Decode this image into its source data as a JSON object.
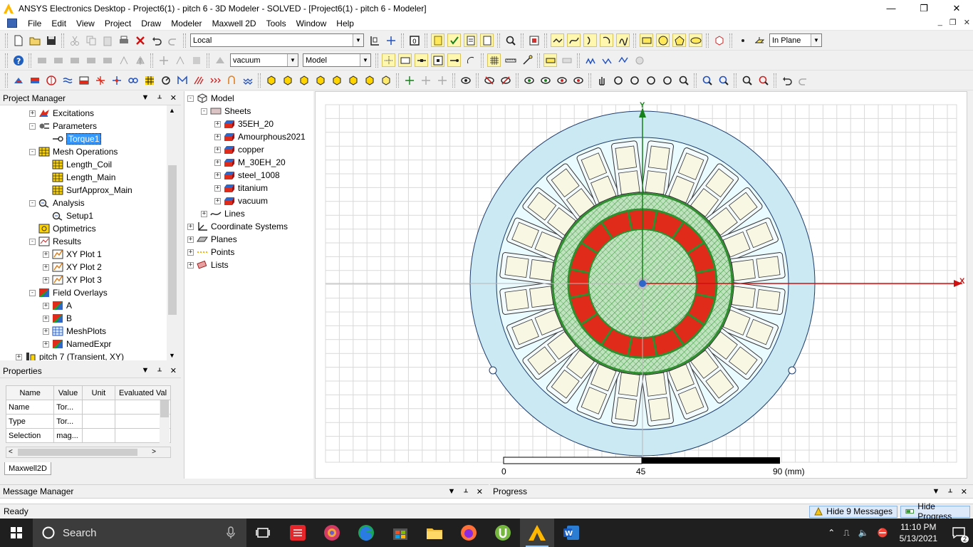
{
  "window": {
    "title": "ANSYS Electronics Desktop - Project6(1) - pitch  6 - 3D Modeler - SOLVED - [Project6(1) - pitch  6 - Modeler]",
    "minimize": "—",
    "maximize": "❐",
    "close": "✕"
  },
  "menu": [
    "File",
    "Edit",
    "View",
    "Project",
    "Draw",
    "Modeler",
    "Maxwell 2D",
    "Tools",
    "Window",
    "Help"
  ],
  "mdi_controls": [
    "_",
    "❐",
    "✕"
  ],
  "toolbar": {
    "coord_system": "Local",
    "plane_mode": "In Plane",
    "material": "vacuum",
    "model_type": "Model"
  },
  "project_manager": {
    "title": "Project Manager",
    "items": [
      {
        "label": "Excitations",
        "icon": "excitation-icon",
        "indent": 1,
        "exp": "+"
      },
      {
        "label": "Parameters",
        "icon": "parameters-icon",
        "indent": 1,
        "exp": "-"
      },
      {
        "label": "Torque1",
        "icon": "torque-icon",
        "indent": 2,
        "exp": "",
        "selected": true
      },
      {
        "label": "Mesh Operations",
        "icon": "mesh-icon",
        "indent": 1,
        "exp": "-"
      },
      {
        "label": "Length_Coil",
        "icon": "mesh-icon",
        "indent": 2,
        "exp": ""
      },
      {
        "label": "Length_Main",
        "icon": "mesh-icon",
        "indent": 2,
        "exp": ""
      },
      {
        "label": "SurfApprox_Main",
        "icon": "mesh-icon",
        "indent": 2,
        "exp": ""
      },
      {
        "label": "Analysis",
        "icon": "analysis-icon",
        "indent": 1,
        "exp": "-"
      },
      {
        "label": "Setup1",
        "icon": "analysis-icon",
        "indent": 2,
        "exp": ""
      },
      {
        "label": "Optimetrics",
        "icon": "optimetrics-icon",
        "indent": 1,
        "exp": ""
      },
      {
        "label": "Results",
        "icon": "results-icon",
        "indent": 1,
        "exp": "-"
      },
      {
        "label": "XY Plot 1",
        "icon": "plot-icon",
        "indent": 2,
        "exp": "+"
      },
      {
        "label": "XY Plot 2",
        "icon": "plot-icon",
        "indent": 2,
        "exp": "+"
      },
      {
        "label": "XY Plot 3",
        "icon": "plot-icon",
        "indent": 2,
        "exp": "+"
      },
      {
        "label": "Field Overlays",
        "icon": "field-icon",
        "indent": 1,
        "exp": "-"
      },
      {
        "label": "A",
        "icon": "field-icon",
        "indent": 2,
        "exp": "+"
      },
      {
        "label": "B",
        "icon": "field-icon",
        "indent": 2,
        "exp": "+"
      },
      {
        "label": "MeshPlots",
        "icon": "meshplot-icon",
        "indent": 2,
        "exp": "+"
      },
      {
        "label": "NamedExpr",
        "icon": "field-icon",
        "indent": 2,
        "exp": "+"
      },
      {
        "label": "pitch  7 (Transient, XY)",
        "icon": "design-icon",
        "indent": 0,
        "exp": "+"
      }
    ]
  },
  "properties": {
    "title": "Properties",
    "headers": [
      "Name",
      "Value",
      "Unit",
      "Evaluated Val"
    ],
    "rows": [
      [
        "Name",
        "Tor...",
        "",
        ""
      ],
      [
        "Type",
        "Tor...",
        "",
        ""
      ],
      [
        "Selection",
        "mag...",
        "",
        ""
      ]
    ],
    "tab": "Maxwell2D"
  },
  "model_tree": {
    "items": [
      {
        "label": "Model",
        "icon": "model-icon",
        "indent": 0,
        "exp": "-"
      },
      {
        "label": "Sheets",
        "icon": "sheets-icon",
        "indent": 1,
        "exp": "-"
      },
      {
        "label": "35EH_20",
        "icon": "material-icon",
        "indent": 2,
        "exp": "+"
      },
      {
        "label": "Amourphous2021",
        "icon": "material-icon",
        "indent": 2,
        "exp": "+"
      },
      {
        "label": "copper",
        "icon": "material-icon",
        "indent": 2,
        "exp": "+"
      },
      {
        "label": "M_30EH_20",
        "icon": "material-icon",
        "indent": 2,
        "exp": "+"
      },
      {
        "label": "steel_1008",
        "icon": "material-icon",
        "indent": 2,
        "exp": "+"
      },
      {
        "label": "titanium",
        "icon": "material-icon",
        "indent": 2,
        "exp": "+"
      },
      {
        "label": "vacuum",
        "icon": "material-icon",
        "indent": 2,
        "exp": "+"
      },
      {
        "label": "Lines",
        "icon": "lines-icon",
        "indent": 1,
        "exp": "+"
      },
      {
        "label": "Coordinate Systems",
        "icon": "coord-icon",
        "indent": 0,
        "exp": "+"
      },
      {
        "label": "Planes",
        "icon": "planes-icon",
        "indent": 0,
        "exp": "+"
      },
      {
        "label": "Points",
        "icon": "points-icon",
        "indent": 0,
        "exp": "+"
      },
      {
        "label": "Lists",
        "icon": "lists-icon",
        "indent": 0,
        "exp": "+"
      }
    ]
  },
  "viewport": {
    "axis_x": "X",
    "axis_y": "Y",
    "scale_labels": [
      "0",
      "45",
      "90 (mm)"
    ],
    "stator_slots": 24,
    "magnet_segments": 16,
    "colors": {
      "outer": "#cbe9f2",
      "stator": "#e9fbff",
      "slot": "#f7f7e4",
      "rotor_green": "#2f8f2f",
      "magnet": "#e02a1a",
      "grid": "#d9d9d9"
    }
  },
  "message_manager": {
    "title": "Message Manager"
  },
  "progress": {
    "title": "Progress"
  },
  "status": {
    "text": "Ready",
    "hide_messages": "Hide 9 Messages",
    "hide_progress": "Hide Progress"
  },
  "taskbar": {
    "search": "Search",
    "time": "11:10 PM",
    "date": "5/13/2021",
    "notifications": "2"
  }
}
